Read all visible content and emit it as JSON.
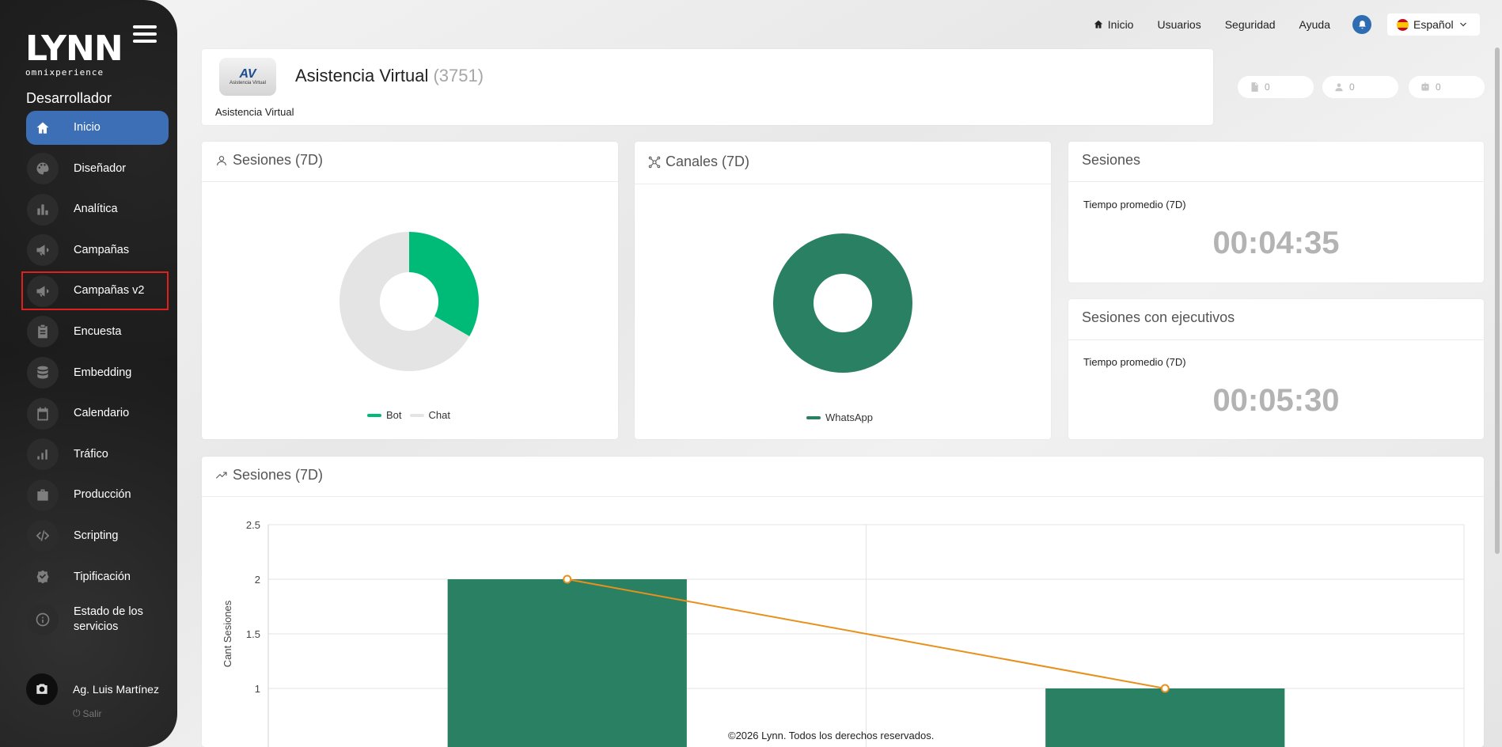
{
  "app": {
    "logo": "LYNN",
    "logo_sub": "omnixperience",
    "role": "Desarrollador"
  },
  "sidebar": {
    "items": [
      {
        "label": "Inicio",
        "icon": "home-icon"
      },
      {
        "label": "Diseñador",
        "icon": "palette-icon"
      },
      {
        "label": "Analítica",
        "icon": "bar-chart-icon"
      },
      {
        "label": "Campañas",
        "icon": "megaphone-icon"
      },
      {
        "label": "Campañas v2",
        "icon": "megaphone-icon"
      },
      {
        "label": "Encuesta",
        "icon": "clipboard-icon"
      },
      {
        "label": "Embedding",
        "icon": "database-icon"
      },
      {
        "label": "Calendario",
        "icon": "calendar-icon"
      },
      {
        "label": "Tráfico",
        "icon": "signal-icon"
      },
      {
        "label": "Producción",
        "icon": "briefcase-icon"
      },
      {
        "label": "Scripting",
        "icon": "code-icon"
      },
      {
        "label": "Tipificación",
        "icon": "badge-check-icon"
      },
      {
        "label": "Estado de los servicios",
        "icon": "info-icon"
      }
    ],
    "user": {
      "name": "Ag. Luis Martínez",
      "logout": "Salir"
    }
  },
  "topnav": {
    "inicio": "Inicio",
    "usuarios": "Usuarios",
    "seguridad": "Seguridad",
    "ayuda": "Ayuda",
    "language": "Español"
  },
  "header": {
    "logo_text": "AV",
    "logo_caption": "Asistencia Virtual",
    "title": "Asistencia Virtual",
    "count": "(3751)",
    "subtitle": "Asistencia Virtual",
    "stats": [
      "0",
      "0",
      "0"
    ]
  },
  "panels": {
    "sesiones_title": "Sesiones (7D)",
    "canales_title": "Canales (7D)",
    "sesiones_time_title": "Sesiones",
    "ejecutivos_title": "Sesiones con ejecutivos",
    "time_label": "Tiempo promedio (7D)",
    "sesiones_time": "00:04:35",
    "ejecutivos_time": "00:05:30",
    "trend_title": "Sesiones (7D)"
  },
  "colors": {
    "primary": "#3d6fb6",
    "green": "#00bb77",
    "dark_green": "#2a8063",
    "orange": "#e8901c",
    "gray": "#e4e4e4"
  },
  "chart_data": [
    {
      "type": "pie",
      "labels": [
        "Bot",
        "Chat"
      ],
      "values": [
        1,
        2
      ],
      "colors": [
        "#00bb77",
        "#e4e4e4"
      ]
    },
    {
      "type": "pie",
      "labels": [
        "WhatsApp"
      ],
      "values": [
        3
      ],
      "colors": [
        "#2a8063"
      ]
    },
    {
      "type": "bar",
      "categories": [
        "",
        ""
      ],
      "values": [
        2,
        1
      ],
      "line_values": [
        2,
        1
      ],
      "ylabel": "Cant Sesiones",
      "ylim": [
        0,
        2.5
      ],
      "yticks": [
        "2.5",
        "2",
        "1.5",
        "1"
      ],
      "grid": true
    }
  ],
  "footer": "©2026 Lynn. Todos los derechos reservados."
}
